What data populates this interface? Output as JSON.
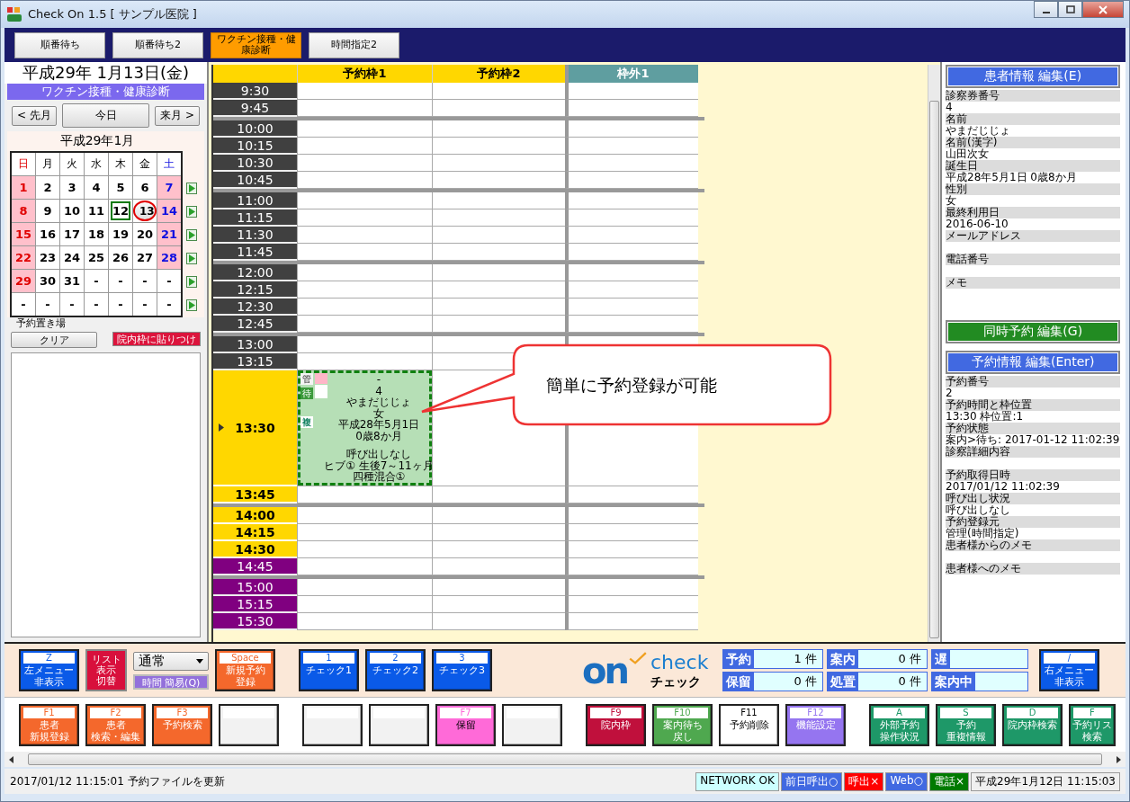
{
  "window": {
    "title": "Check On 1.5 [ サンプル医院 ]"
  },
  "tabs": [
    {
      "label": "順番待ち",
      "selected": false
    },
    {
      "label": "順番待ち2",
      "selected": false
    },
    {
      "label": "ワクチン接種・健康診断",
      "selected": true
    },
    {
      "label": "時間指定2",
      "selected": false
    }
  ],
  "left": {
    "date": "平成29年 1月13日(金)",
    "category": "ワクチン接種・健康診断",
    "prev": "< 先月",
    "today": "今日",
    "next": "来月 >",
    "calendar": {
      "month": "平成29年1月",
      "weekdays": [
        "日",
        "月",
        "火",
        "水",
        "木",
        "金",
        "土"
      ],
      "weeks": [
        [
          {
            "text": "1",
            "kind": "day",
            "selected": false,
            "today": false
          },
          {
            "text": "2",
            "kind": "day",
            "selected": false,
            "today": false
          },
          {
            "text": "3",
            "kind": "day",
            "selected": false,
            "today": false
          },
          {
            "text": "4",
            "kind": "day",
            "selected": false,
            "today": false
          },
          {
            "text": "5",
            "kind": "day",
            "selected": false,
            "today": false
          },
          {
            "text": "6",
            "kind": "day",
            "selected": false,
            "today": false
          },
          {
            "text": "7",
            "kind": "day",
            "selected": false,
            "today": false
          }
        ],
        [
          {
            "text": "8",
            "kind": "day",
            "selected": false,
            "today": false
          },
          {
            "text": "9",
            "kind": "day",
            "selected": false,
            "today": false
          },
          {
            "text": "10",
            "kind": "day",
            "selected": false,
            "today": false
          },
          {
            "text": "11",
            "kind": "day",
            "selected": false,
            "today": false
          },
          {
            "text": "12",
            "kind": "day",
            "selected": false,
            "today": true
          },
          {
            "text": "13",
            "kind": "day",
            "selected": true,
            "today": false
          },
          {
            "text": "14",
            "kind": "day",
            "selected": false,
            "today": false
          }
        ],
        [
          {
            "text": "15",
            "kind": "day",
            "selected": false,
            "today": false
          },
          {
            "text": "16",
            "kind": "day",
            "selected": false,
            "today": false
          },
          {
            "text": "17",
            "kind": "day",
            "selected": false,
            "today": false
          },
          {
            "text": "18",
            "kind": "day",
            "selected": false,
            "today": false
          },
          {
            "text": "19",
            "kind": "day",
            "selected": false,
            "today": false
          },
          {
            "text": "20",
            "kind": "day",
            "selected": false,
            "today": false
          },
          {
            "text": "21",
            "kind": "day",
            "selected": false,
            "today": false
          }
        ],
        [
          {
            "text": "22",
            "kind": "day",
            "selected": false,
            "today": false
          },
          {
            "text": "23",
            "kind": "day",
            "selected": false,
            "today": false
          },
          {
            "text": "24",
            "kind": "day",
            "selected": false,
            "today": false
          },
          {
            "text": "25",
            "kind": "day",
            "selected": false,
            "today": false
          },
          {
            "text": "26",
            "kind": "day",
            "selected": false,
            "today": false
          },
          {
            "text": "27",
            "kind": "day",
            "selected": false,
            "today": false
          },
          {
            "text": "28",
            "kind": "day",
            "selected": false,
            "today": false
          }
        ],
        [
          {
            "text": "29",
            "kind": "day",
            "selected": false,
            "today": false
          },
          {
            "text": "30",
            "kind": "day",
            "selected": false,
            "today": false
          },
          {
            "text": "31",
            "kind": "day",
            "selected": false,
            "today": false
          },
          {
            "text": "-",
            "kind": "blank",
            "selected": false,
            "today": false
          },
          {
            "text": "-",
            "kind": "blank",
            "selected": false,
            "today": false
          },
          {
            "text": "-",
            "kind": "blank",
            "selected": false,
            "today": false
          },
          {
            "text": "-",
            "kind": "blank",
            "selected": false,
            "today": false
          }
        ],
        [
          {
            "text": "-",
            "kind": "blank",
            "selected": false,
            "today": false
          },
          {
            "text": "-",
            "kind": "blank",
            "selected": false,
            "today": false
          },
          {
            "text": "-",
            "kind": "blank",
            "selected": false,
            "today": false
          },
          {
            "text": "-",
            "kind": "blank",
            "selected": false,
            "today": false
          },
          {
            "text": "-",
            "kind": "blank",
            "selected": false,
            "today": false
          },
          {
            "text": "-",
            "kind": "blank",
            "selected": false,
            "today": false
          },
          {
            "text": "-",
            "kind": "blank",
            "selected": false,
            "today": false
          }
        ]
      ]
    },
    "holding": {
      "label": "予約置き場",
      "clear": "クリア",
      "paste": "院内枠に貼りつけ"
    }
  },
  "schedule": {
    "columns": [
      {
        "label": "予約枠1",
        "color": "#ffd700"
      },
      {
        "label": "予約枠2",
        "color": "#ffd700"
      },
      {
        "label": "枠外1",
        "color": "#5f9ea0"
      }
    ],
    "groups": [
      {
        "slots": [
          {
            "time": "9:30",
            "color": "#404040",
            "current": false
          },
          {
            "time": "9:45",
            "color": "#404040",
            "current": false
          }
        ]
      },
      {
        "slots": [
          {
            "time": "10:00",
            "color": "#404040",
            "current": false
          },
          {
            "time": "10:15",
            "color": "#404040",
            "current": false
          },
          {
            "time": "10:30",
            "color": "#404040",
            "current": false
          },
          {
            "time": "10:45",
            "color": "#404040",
            "current": false
          }
        ]
      },
      {
        "slots": [
          {
            "time": "11:00",
            "color": "#404040",
            "current": false
          },
          {
            "time": "11:15",
            "color": "#404040",
            "current": false
          },
          {
            "time": "11:30",
            "color": "#404040",
            "current": false
          },
          {
            "time": "11:45",
            "color": "#404040",
            "current": false
          }
        ]
      },
      {
        "slots": [
          {
            "time": "12:00",
            "color": "#404040",
            "current": false
          },
          {
            "time": "12:15",
            "color": "#404040",
            "current": false
          },
          {
            "time": "12:30",
            "color": "#404040",
            "current": false
          },
          {
            "time": "12:45",
            "color": "#404040",
            "current": false
          }
        ]
      },
      {
        "slots": [
          {
            "time": "13:00",
            "color": "#404040",
            "current": false
          },
          {
            "time": "13:15",
            "color": "#404040",
            "current": false
          },
          {
            "time": "13:30",
            "color": "#ffd700",
            "current": true,
            "appointment": {
              "badges": [
                "管",
                "待",
                "複"
              ],
              "lines": [
                "-",
                "4",
                "やまだじじょ",
                "女",
                "平成28年5月1日",
                "0歳8か月"
              ],
              "notes": [
                "呼び出しなし",
                "ヒブ① 生後7～11ヶ月",
                "四種混合①"
              ]
            }
          },
          {
            "time": "13:45",
            "color": "#ffd700",
            "current": false
          }
        ]
      },
      {
        "slots": [
          {
            "time": "14:00",
            "color": "#ffd700",
            "current": false
          },
          {
            "time": "14:15",
            "color": "#ffd700",
            "current": false
          },
          {
            "time": "14:30",
            "color": "#ffd700",
            "current": false
          },
          {
            "time": "14:45",
            "color": "#800080",
            "current": false
          }
        ]
      },
      {
        "slots": [
          {
            "time": "15:00",
            "color": "#800080",
            "current": false
          },
          {
            "time": "15:15",
            "color": "#800080",
            "current": false
          },
          {
            "time": "15:30",
            "color": "#800080",
            "current": false
          }
        ]
      }
    ]
  },
  "callout": {
    "text": "簡単に予約登録が可能"
  },
  "right": {
    "patient_button": "患者情報 編集(E)",
    "patient_fields": [
      {
        "label": "診察券番号",
        "value": "4"
      },
      {
        "label": "名前",
        "value": "やまだじじょ"
      },
      {
        "label": "名前(漢字)",
        "value": "山田次女"
      },
      {
        "label": "誕生日",
        "value": "平成28年5月1日 0歳8か月"
      },
      {
        "label": "性別",
        "value": "女"
      },
      {
        "label": "最終利用日",
        "value": "2016-06-10"
      },
      {
        "label": "メールアドレス"
      },
      {
        "label": "電話番号"
      },
      {
        "label": "メモ"
      }
    ],
    "group_button": "同時予約 編集(G)",
    "reservation_button": "予約情報 編集(Enter)",
    "reservation_fields": [
      {
        "label": "予約番号",
        "value": "2"
      },
      {
        "label": "予約時間と枠位置",
        "value": "13:30 枠位置:1"
      },
      {
        "label": "予約状態",
        "value": "案内>待ち: 2017-01-12 11:02:39"
      },
      {
        "label": "診察詳細内容"
      },
      {
        "label": "予約取得日時",
        "value": "2017/01/12 11:02:39"
      },
      {
        "label": "呼び出し状況",
        "value": "呼び出しなし"
      },
      {
        "label": "予約登録元",
        "value": "管理(時間指定)"
      },
      {
        "label": "患者様からのメモ"
      },
      {
        "label": "患者様へのメモ"
      }
    ]
  },
  "toolbar": {
    "left": [
      {
        "kind": "key",
        "key": "Z",
        "lines": [
          "左メニュー",
          "非表示"
        ],
        "color": "#0a5ae8"
      },
      {
        "kind": "plain",
        "lines": [
          "リスト",
          "表示",
          "切替"
        ],
        "color": "#d8103c"
      },
      {
        "kind": "mode",
        "value": "通常",
        "button": "時間 簡易(Q)"
      },
      {
        "kind": "key",
        "key": "Space",
        "lines": [
          "新規予約",
          "登録"
        ],
        "color": "#f4682c"
      }
    ],
    "checks": [
      {
        "kind": "key",
        "key": "1",
        "lines": [
          "チェック1"
        ],
        "color": "#0a5ae8"
      },
      {
        "kind": "key",
        "key": "2",
        "lines": [
          "チェック2"
        ],
        "color": "#0a5ae8"
      },
      {
        "kind": "key",
        "key": "3",
        "lines": [
          "チェック3"
        ],
        "color": "#0a5ae8"
      }
    ],
    "logo": {
      "mark": "on",
      "word": "check",
      "kana": "チェック"
    },
    "counters": [
      {
        "label": "予約",
        "value": "1 件"
      },
      {
        "label": "案内",
        "value": "0 件"
      },
      {
        "label": "遅"
      },
      {
        "label": "保留",
        "value": "0 件"
      },
      {
        "label": "処置",
        "value": "0 件"
      },
      {
        "label": "案内中"
      }
    ],
    "right": {
      "kind": "key",
      "key": "/",
      "lines": [
        "右メニュー",
        "非表示"
      ],
      "color": "#0a5ae8"
    }
  },
  "function_keys": [
    [
      {
        "kind": "key",
        "key": "F1",
        "lines": [
          "患者",
          "新規登録"
        ],
        "color": "#f4682c"
      },
      {
        "kind": "key",
        "key": "F2",
        "lines": [
          "患者",
          "検索・編集"
        ],
        "color": "#f4682c"
      },
      {
        "kind": "key",
        "key": "F3",
        "lines": [
          "予約検索"
        ],
        "color": "#f4682c"
      },
      {
        "kind": "blank",
        "color": "#f2f2f2"
      }
    ],
    [
      {
        "kind": "blank",
        "color": "#f2f2f2"
      },
      {
        "kind": "blank",
        "color": "#f2f2f2"
      },
      {
        "kind": "key",
        "key": "F7",
        "lines": [
          "保留"
        ],
        "color": "#ff6ad8"
      },
      {
        "kind": "blank",
        "color": "#f2f2f2"
      }
    ],
    [
      {
        "kind": "key",
        "key": "F9",
        "lines": [
          "院内枠"
        ],
        "color": "#c0103c"
      },
      {
        "kind": "key",
        "key": "F10",
        "lines": [
          "案内待ち",
          "戻し"
        ],
        "color": "#4fa84f"
      },
      {
        "kind": "key",
        "key": "F11",
        "lines": [
          "予約削除"
        ],
        "color": "#ffffff"
      },
      {
        "kind": "key",
        "key": "F12",
        "lines": [
          "機能設定"
        ],
        "color": "#9575f0"
      }
    ],
    [
      {
        "kind": "key",
        "key": "A",
        "lines": [
          "外部予約",
          "操作状況"
        ],
        "color": "#1e9868"
      },
      {
        "kind": "key",
        "key": "S",
        "lines": [
          "予約",
          "重複情報"
        ],
        "color": "#1e9868"
      },
      {
        "kind": "key",
        "key": "D",
        "lines": [
          "院内枠検索"
        ],
        "color": "#1e9868"
      },
      {
        "kind": "key",
        "key": "F",
        "lines": [
          "予約リス",
          "検索"
        ],
        "color": "#1e9868"
      }
    ]
  ],
  "status_bar": {
    "message": "2017/01/12 11:15:01 予約ファイルを更新",
    "indicators": [
      {
        "text": "NETWORK OK",
        "color": "#ccffff"
      },
      {
        "text": "前日呼出○",
        "color": "#4169e1"
      },
      {
        "text": "呼出×",
        "color": "#ff0000"
      },
      {
        "text": "Web○",
        "color": "#4169e1"
      },
      {
        "text": "電話×",
        "color": "#007a00"
      },
      {
        "text": "平成29年1月12日 11:15:03",
        "color": "#f0f0f0"
      }
    ]
  }
}
